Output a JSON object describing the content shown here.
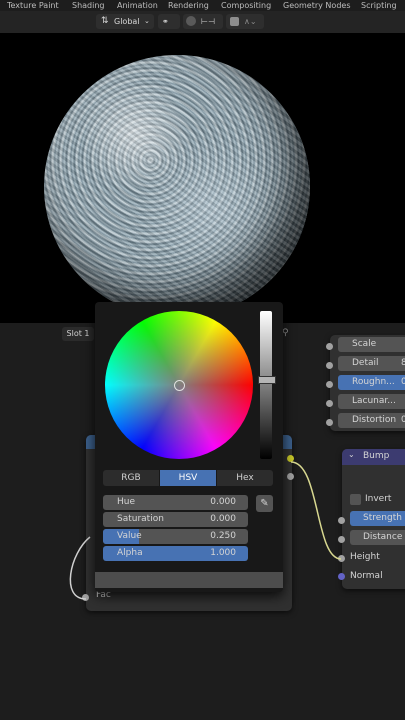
{
  "workspace_tabs": [
    "Texture Paint",
    "Shading",
    "Animation",
    "Rendering",
    "Compositing",
    "Geometry Nodes",
    "Scripting"
  ],
  "toolbar": {
    "orientation": "Global",
    "dropdown_icon": "chevron-down-icon"
  },
  "slot": "Slot 1",
  "color_picker": {
    "modes": [
      "RGB",
      "HSV",
      "Hex"
    ],
    "active_mode": "HSV",
    "properties": [
      {
        "label": "Hue",
        "value": "0.000",
        "fill": 0
      },
      {
        "label": "Saturation",
        "value": "0.000",
        "fill": 0
      },
      {
        "label": "Value",
        "value": "0.250",
        "fill": 0.25
      },
      {
        "label": "Alpha",
        "value": "1.000",
        "fill": 1
      }
    ]
  },
  "color_ramp_node": {
    "output_socket": "Fac"
  },
  "noise_node": {
    "rows": [
      {
        "label": "Scale",
        "value": ""
      },
      {
        "label": "Detail",
        "value": "8"
      },
      {
        "label": "Roughn...",
        "value": "0"
      },
      {
        "label": "Lacunar...",
        "value": ""
      },
      {
        "label": "Distortion",
        "value": "0"
      }
    ]
  },
  "bump_node": {
    "title": "Bump",
    "invert_label": "Invert",
    "strength_label": "Strength",
    "distance_label": "Distance",
    "height_label": "Height",
    "normal_label": "Normal"
  },
  "colors": {
    "accent": "#4772b3",
    "bump_header": "#3c3b70",
    "node_body": "#303030",
    "socket_gray": "#a1a1a1",
    "socket_yellow": "#c7c729",
    "socket_purple": "#6363c7"
  }
}
